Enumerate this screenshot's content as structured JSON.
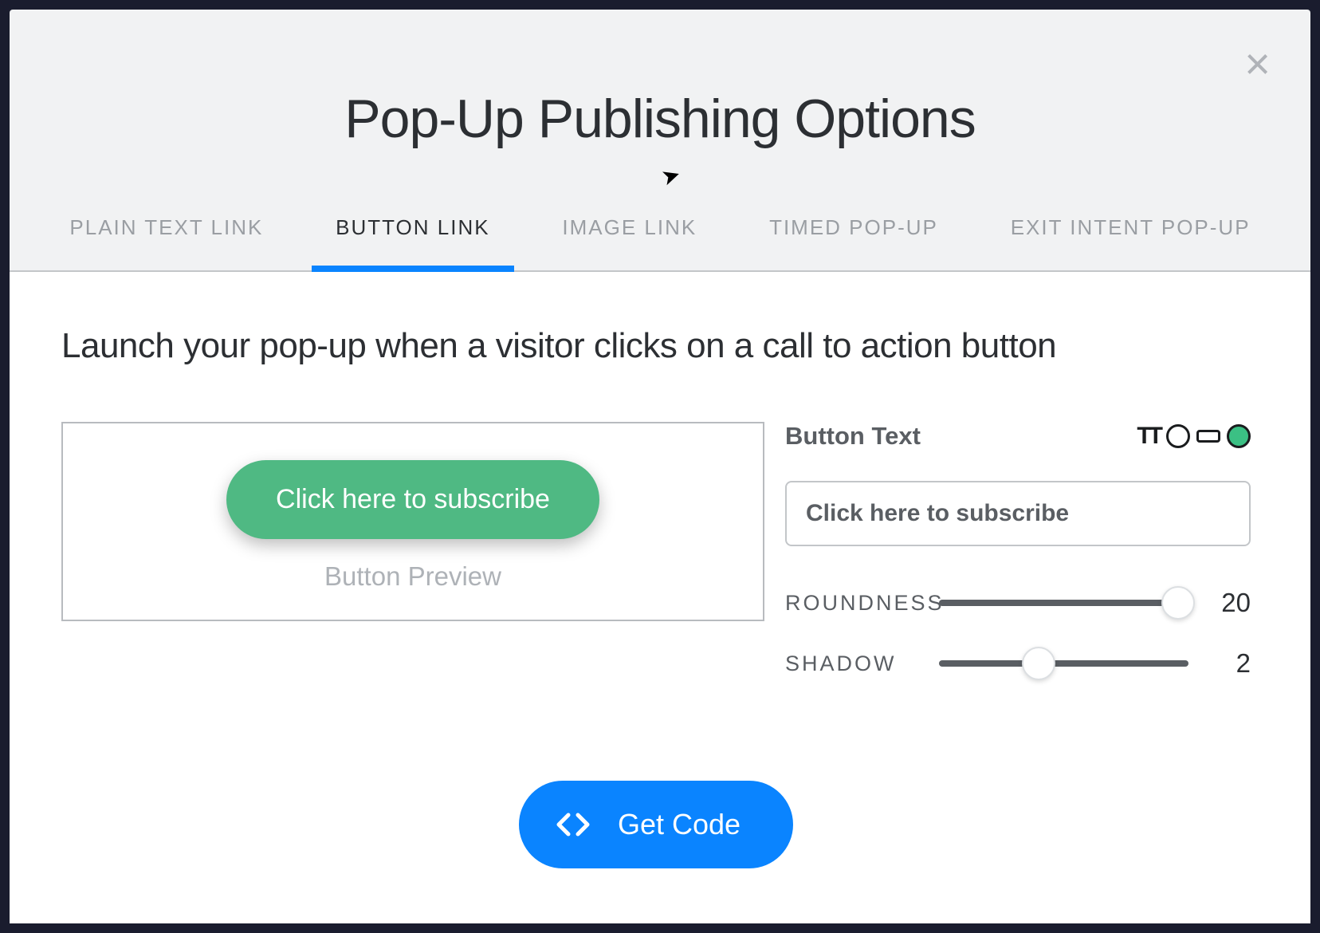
{
  "modal": {
    "title": "Pop-Up Publishing Options"
  },
  "tabs": [
    {
      "label": "PLAIN TEXT LINK",
      "active": false
    },
    {
      "label": "BUTTON LINK",
      "active": true
    },
    {
      "label": "IMAGE LINK",
      "active": false
    },
    {
      "label": "TIMED POP-UP",
      "active": false
    },
    {
      "label": "EXIT INTENT POP-UP",
      "active": false
    }
  ],
  "description": "Launch your pop-up when a visitor clicks on a call to action button",
  "preview": {
    "button_text": "Click here to subscribe",
    "label": "Button Preview"
  },
  "controls": {
    "button_text_label": "Button Text",
    "button_text_value": "Click here to subscribe",
    "roundness": {
      "label": "ROUNDNESS",
      "value": "20",
      "percent": 96
    },
    "shadow": {
      "label": "SHADOW",
      "value": "2",
      "percent": 40
    }
  },
  "get_code_label": "Get Code",
  "colors": {
    "accent_blue": "#0a84ff",
    "accent_green": "#4fb983"
  }
}
